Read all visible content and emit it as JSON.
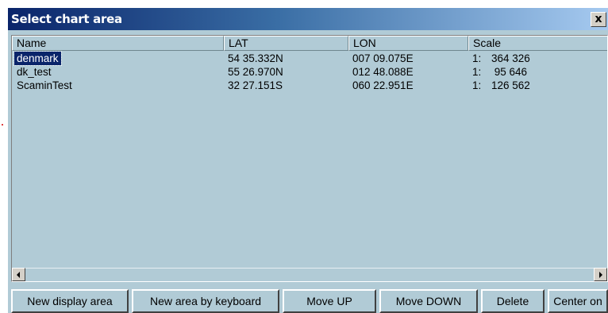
{
  "window": {
    "title": "Select chart area",
    "close_label": "x"
  },
  "list": {
    "columns": [
      "Name",
      "LAT",
      "LON",
      "Scale"
    ],
    "rows": [
      {
        "name": "denmark",
        "lat": "54 35.332N",
        "lon": "007 09.075E",
        "scale_prefix": "1:",
        "scale": "364 326",
        "selected": true
      },
      {
        "name": "dk_test",
        "lat": "55 26.970N",
        "lon": "012 48.088E",
        "scale_prefix": "1:",
        "scale": " 95 646",
        "selected": false
      },
      {
        "name": "ScaminTest",
        "lat": "32 27.151S",
        "lon": "060 22.951E",
        "scale_prefix": "1:",
        "scale": "126 562",
        "selected": false
      }
    ]
  },
  "buttons": {
    "new_display_area": "New display area",
    "new_area_by_keyboard": "New area by keyboard",
    "move_up": "Move UP",
    "move_down": "Move DOWN",
    "delete": "Delete",
    "center_on": "Center on"
  },
  "colors": {
    "background": "#b1cbd6",
    "title_start": "#0a246a",
    "title_end": "#a6caf0",
    "selection": "#0a246a"
  }
}
